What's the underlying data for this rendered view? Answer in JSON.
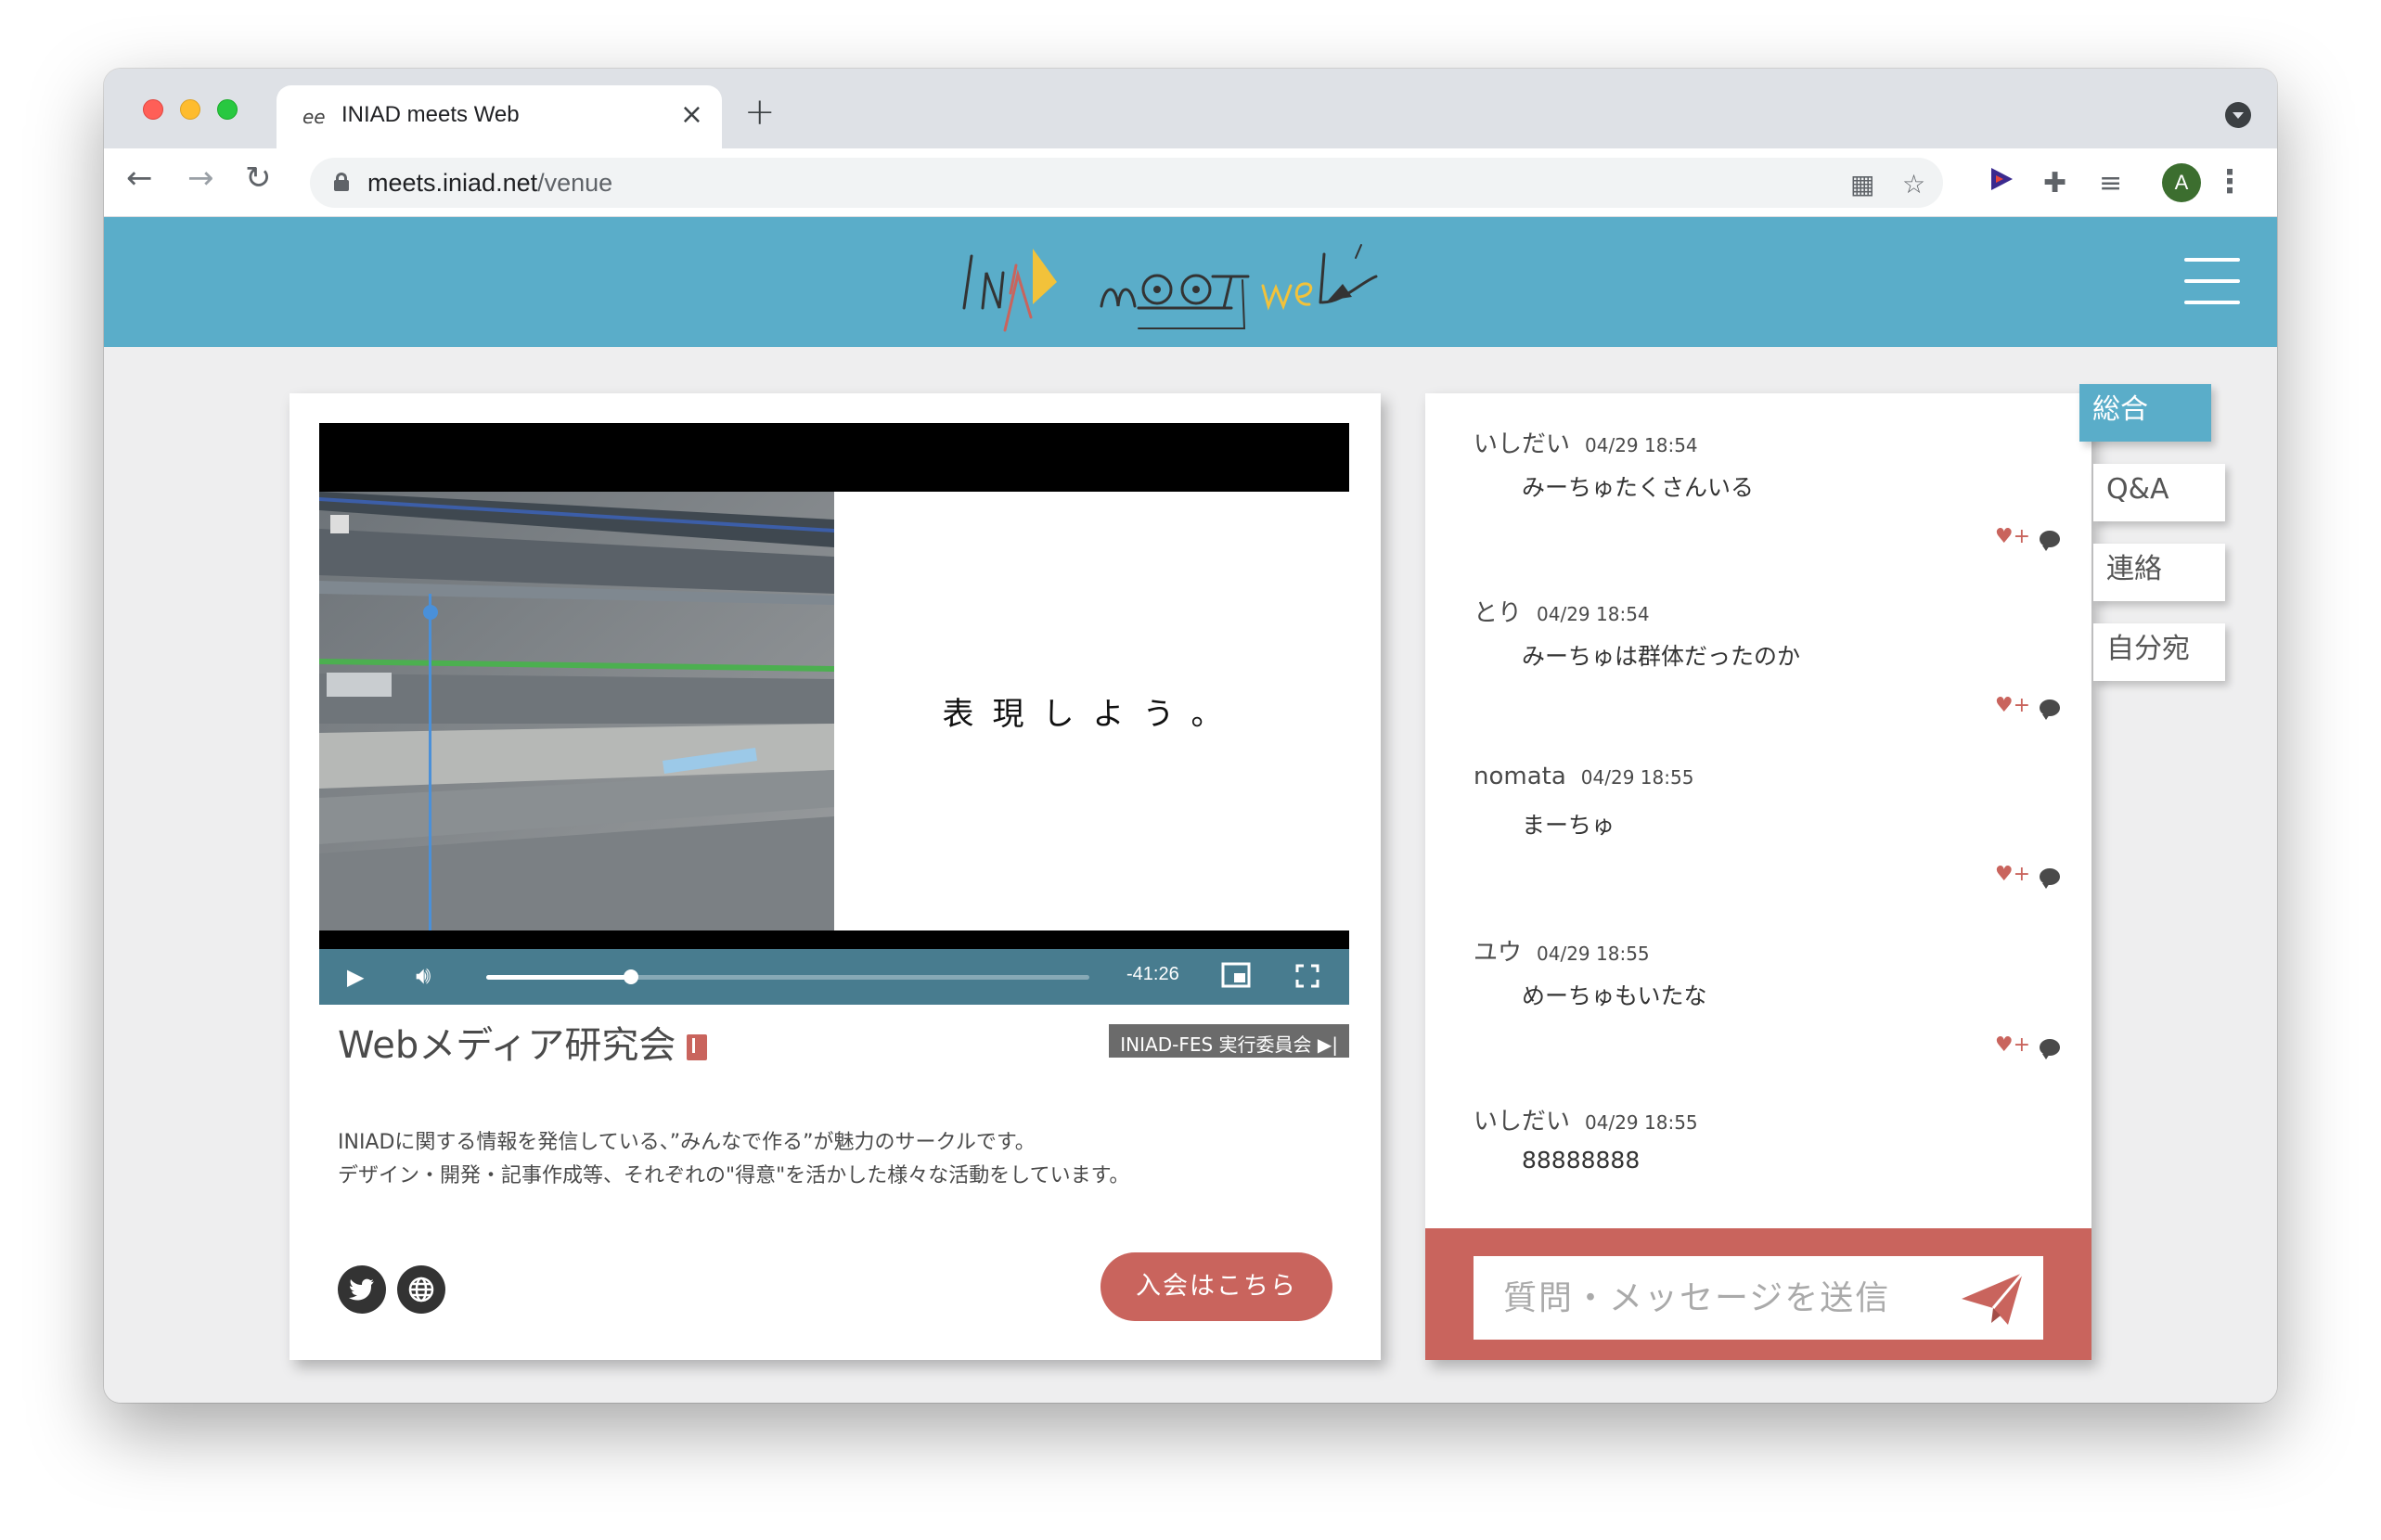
{
  "browser": {
    "tab_title": "INIAD meets Web",
    "tab_favicon": "ee",
    "url_host": "meets.iniad.net",
    "url_path": "/venue",
    "avatar_initial": "A"
  },
  "site": {
    "brand_color": "#5aadc9",
    "accent_color": "#c9645d"
  },
  "video": {
    "slogan": "表現しよう。",
    "time_remaining": "-41:26",
    "progress": 0.24
  },
  "circle": {
    "name": "Webメディア研究会",
    "org_badge": "INIAD-FES 実行委員会 ▶|",
    "description_line1": "INIADに関する情報を発信している、”みんなで作る”が魅力のサークルです。",
    "description_line2": "デザイン・開発・記事作成等、それぞれの\"得意\"を活かした様々な活動をしています。",
    "join_label": "入会はこちら"
  },
  "chat": {
    "messages": [
      {
        "user": "いしだい",
        "time": "04/29 18:54",
        "text": "みーちゅたくさんいる"
      },
      {
        "user": "とり",
        "time": "04/29 18:54",
        "text": "みーちゅは群体だったのか"
      },
      {
        "user": "nomata",
        "time": "04/29 18:55",
        "text": "まーちゅ"
      },
      {
        "user": "ユウ",
        "time": "04/29 18:55",
        "text": "めーちゅもいたな"
      },
      {
        "user": "いしだい",
        "time": "04/29 18:55",
        "text": "88888888"
      }
    ],
    "input_placeholder": "質問・メッセージを送信"
  },
  "side_tabs": [
    {
      "label": "総合",
      "active": true
    },
    {
      "label": "Q&A",
      "active": false
    },
    {
      "label": "連絡",
      "active": false
    },
    {
      "label": "自分宛",
      "active": false
    }
  ]
}
